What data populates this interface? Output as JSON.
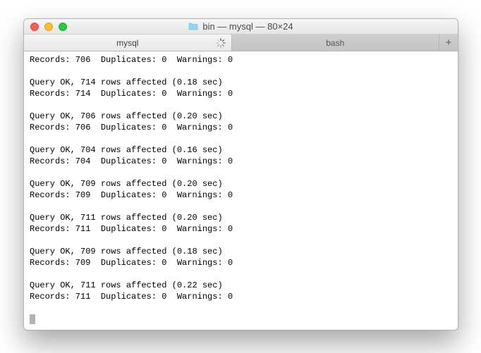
{
  "window": {
    "title": "bin — mysql — 80×24"
  },
  "tabs": {
    "active_label": "mysql",
    "inactive_label": "bash",
    "add_label": "+"
  },
  "terminal": {
    "top_records": {
      "records": 706,
      "duplicates": 0,
      "warnings": 0
    },
    "queries": [
      {
        "rows": 714,
        "time": "0.18",
        "records": 714,
        "duplicates": 0,
        "warnings": 0
      },
      {
        "rows": 706,
        "time": "0.20",
        "records": 706,
        "duplicates": 0,
        "warnings": 0
      },
      {
        "rows": 704,
        "time": "0.16",
        "records": 704,
        "duplicates": 0,
        "warnings": 0
      },
      {
        "rows": 709,
        "time": "0.20",
        "records": 709,
        "duplicates": 0,
        "warnings": 0
      },
      {
        "rows": 711,
        "time": "0.20",
        "records": 711,
        "duplicates": 0,
        "warnings": 0
      },
      {
        "rows": 709,
        "time": "0.18",
        "records": 709,
        "duplicates": 0,
        "warnings": 0
      },
      {
        "rows": 711,
        "time": "0.22",
        "records": 711,
        "duplicates": 0,
        "warnings": 0
      }
    ]
  }
}
